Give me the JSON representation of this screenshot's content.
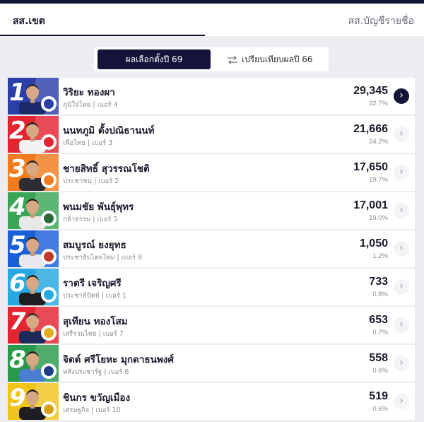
{
  "tabs": {
    "left": "สส.เขต",
    "right": "สส.บัญชีรายชื่อ"
  },
  "toggle": {
    "active": "ผลเลือกตั้งปี 69",
    "other": "เปรียบเทียบผลปี 66"
  },
  "colors": {
    "navy": "#14143a"
  },
  "candidates": [
    {
      "rank": "1",
      "name": "วิริยะ ทองผา",
      "sub": "ภูมิใจไทย | เบอร์ 4",
      "votes": "29,345",
      "pct": "32.7%",
      "color": "#2b3fa8",
      "logo": "#2b3fa8",
      "shirt": "#1b2a6b"
    },
    {
      "rank": "2",
      "name": "นนทภูมิ ตั้งปณิธานนท์",
      "sub": "เพื่อไทย | เบอร์ 3",
      "votes": "21,666",
      "pct": "24.2%",
      "color": "#e32431",
      "logo": "#e32431",
      "shirt": "#f2f2f2"
    },
    {
      "rank": "3",
      "name": "ชายสิทธิ์ สุวรรณโชติ",
      "sub": "ประชาชน | เบอร์ 2",
      "votes": "17,650",
      "pct": "19.7%",
      "color": "#f07c1e",
      "logo": "#f07c1e",
      "shirt": "#2d2d33"
    },
    {
      "rank": "4",
      "name": "พนมชัย พันธุ์พุทร",
      "sub": "กล้าธรรม | เบอร์ 5",
      "votes": "17,001",
      "pct": "19.0%",
      "color": "#3aa655",
      "logo": "#2a6b3a",
      "shirt": "#e8e8e8"
    },
    {
      "rank": "5",
      "name": "สมบูรณ์ ยงยุทธ",
      "sub": "ประชาธิปไตยใหม่ | เบอร์ 9",
      "votes": "1,050",
      "pct": "1.2%",
      "color": "#1a5ed8",
      "logo": "#c0392b",
      "shirt": "#e8e8ee"
    },
    {
      "rank": "6",
      "name": "ราตรี เจริญศรี",
      "sub": "ประชาธิปัตย์ | เบอร์ 1",
      "votes": "733",
      "pct": "0.8%",
      "color": "#27a8e0",
      "logo": "#27a8e0",
      "shirt": "#1d1d22"
    },
    {
      "rank": "7",
      "name": "สุเทียน ทองโสม",
      "sub": "เสรีรวมไทย | เบอร์ 7",
      "votes": "653",
      "pct": "0.7%",
      "color": "#e32431",
      "logo": "#e0b020",
      "shirt": "#1c2a5a"
    },
    {
      "rank": "8",
      "name": "จิตต์ ศรีโยหะ มุกดาธนพงศ์",
      "sub": "พลังประชารัฐ | เบอร์ 6",
      "votes": "558",
      "pct": "0.6%",
      "color": "#2a9a4a",
      "logo": "#1f3d8a",
      "shirt": "#4a7fd0"
    },
    {
      "rank": "9",
      "name": "ชินกร ขวัญเมือง",
      "sub": "เศรษฐกิจ | เบอร์ 10",
      "votes": "519",
      "pct": "0.6%",
      "color": "#f0c419",
      "logo": "#d4a017",
      "shirt": "#1d1d22"
    }
  ]
}
